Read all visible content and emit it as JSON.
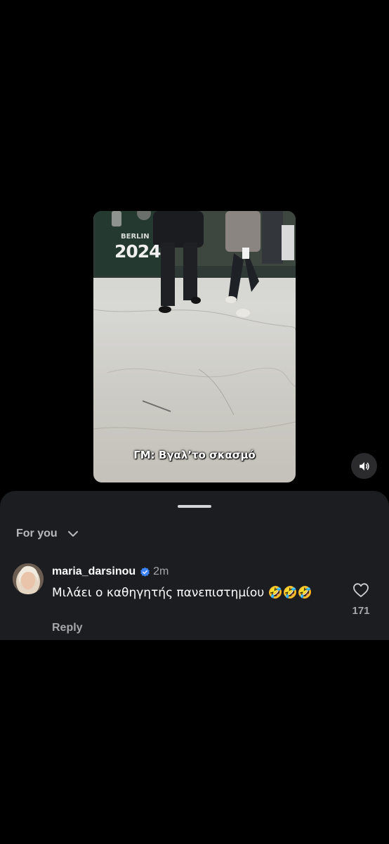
{
  "video": {
    "caption": "ΓΜ: Βγαλ’το σκασμό",
    "banner_city": "BERLIN",
    "banner_year": "2024"
  },
  "sound_button": {
    "icon": "speaker-icon"
  },
  "comments_sheet": {
    "feed_selector": {
      "label": "For you",
      "icon": "chevron-down-icon"
    },
    "comments": [
      {
        "username": "maria_darsinou",
        "verified": true,
        "time": "2m",
        "text": "Μιλάει ο καθηγητής πανεπιστημίου 🤣🤣🤣",
        "reply_label": "Reply",
        "likes": "171"
      }
    ]
  },
  "colors": {
    "background": "#000000",
    "sheet": "#1c1d20",
    "secondary_text": "#a6a7ac",
    "verified": "#3b82f6"
  }
}
